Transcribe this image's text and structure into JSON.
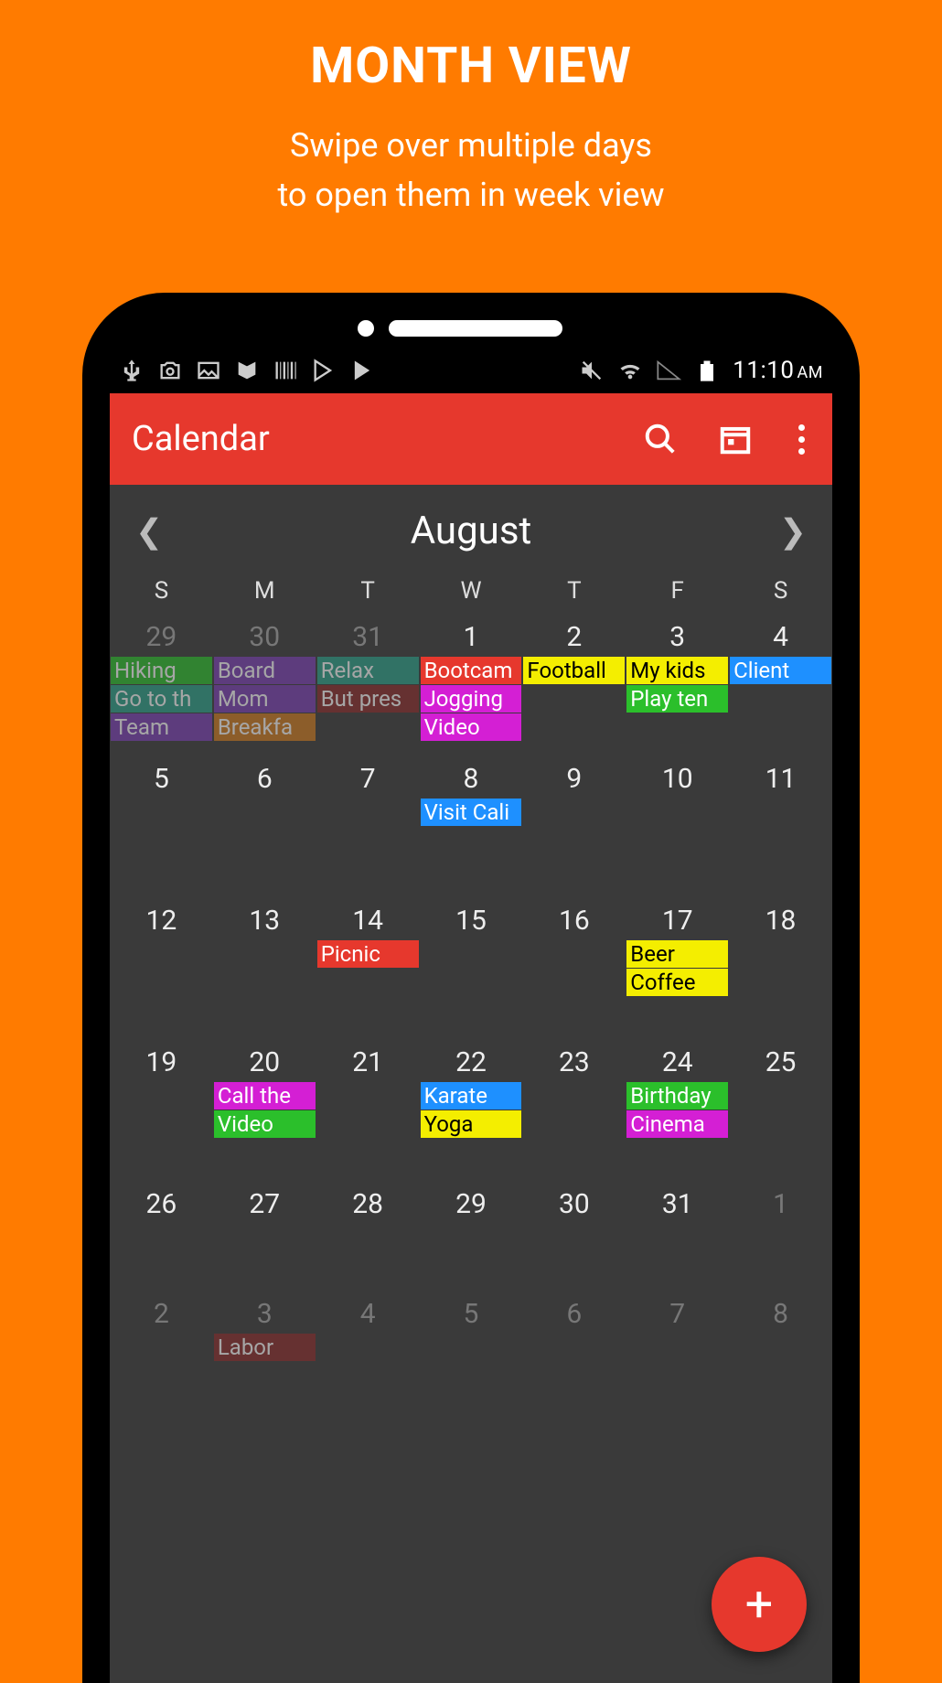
{
  "promo": {
    "title": "MONTH VIEW",
    "subtitle1": "Swipe over multiple days",
    "subtitle2": "to open them in week view"
  },
  "statusbar": {
    "time": "11:10",
    "ampm": "AM"
  },
  "appbar": {
    "title": "Calendar"
  },
  "month": "August",
  "dow": [
    "S",
    "M",
    "T",
    "W",
    "T",
    "F",
    "S"
  ],
  "colors": {
    "green": "#2bbf2b",
    "purple": "#7a3fb5",
    "blue": "#1e90ff",
    "yellow": "#f4ee00",
    "magenta": "#d41fd4",
    "red": "#e6382d",
    "teal": "#2aa089",
    "orange": "#d07a1e",
    "darkred": "#8a2a2a"
  },
  "weeks": [
    [
      {
        "n": "29",
        "dim": true,
        "ev": [
          {
            "t": "Hiking",
            "c": "green",
            "dark": false
          },
          {
            "t": "Go to th",
            "c": "teal",
            "dark": false
          },
          {
            "t": "Team",
            "c": "purple",
            "dark": false
          }
        ]
      },
      {
        "n": "30",
        "dim": true,
        "ev": [
          {
            "t": "Board",
            "c": "purple",
            "dark": false
          },
          {
            "t": "Mom",
            "c": "purple",
            "dark": false
          },
          {
            "t": "Breakfa",
            "c": "orange",
            "dark": false
          }
        ]
      },
      {
        "n": "31",
        "dim": true,
        "ev": [
          {
            "t": "Relax",
            "c": "teal",
            "dark": false
          },
          {
            "t": "But pres",
            "c": "darkred",
            "dark": false
          }
        ]
      },
      {
        "n": "1",
        "dim": false,
        "ev": [
          {
            "t": "Bootcam",
            "c": "red",
            "dark": false
          },
          {
            "t": "Jogging",
            "c": "magenta",
            "dark": false
          },
          {
            "t": "Video",
            "c": "magenta",
            "dark": false
          }
        ]
      },
      {
        "n": "2",
        "dim": false,
        "ev": [
          {
            "t": "Football",
            "c": "yellow",
            "dark": true
          }
        ]
      },
      {
        "n": "3",
        "dim": false,
        "ev": [
          {
            "t": "My kids",
            "c": "yellow",
            "dark": true
          },
          {
            "t": "Play ten",
            "c": "green",
            "dark": false
          }
        ]
      },
      {
        "n": "4",
        "dim": false,
        "ev": [
          {
            "t": "Client",
            "c": "blue",
            "dark": false
          }
        ]
      }
    ],
    [
      {
        "n": "5",
        "dim": false,
        "ev": []
      },
      {
        "n": "6",
        "dim": false,
        "ev": []
      },
      {
        "n": "7",
        "dim": false,
        "ev": []
      },
      {
        "n": "8",
        "dim": false,
        "ev": [
          {
            "t": "Visit Cali",
            "c": "blue",
            "dark": false
          }
        ]
      },
      {
        "n": "9",
        "dim": false,
        "ev": []
      },
      {
        "n": "10",
        "dim": false,
        "ev": []
      },
      {
        "n": "11",
        "dim": false,
        "ev": []
      }
    ],
    [
      {
        "n": "12",
        "dim": false,
        "ev": []
      },
      {
        "n": "13",
        "dim": false,
        "ev": []
      },
      {
        "n": "14",
        "dim": false,
        "ev": [
          {
            "t": "Picnic",
            "c": "red",
            "dark": false
          }
        ]
      },
      {
        "n": "15",
        "dim": false,
        "ev": []
      },
      {
        "n": "16",
        "dim": false,
        "ev": []
      },
      {
        "n": "17",
        "dim": false,
        "ev": [
          {
            "t": "Beer",
            "c": "yellow",
            "dark": true
          },
          {
            "t": "Coffee",
            "c": "yellow",
            "dark": true
          }
        ]
      },
      {
        "n": "18",
        "dim": false,
        "ev": []
      }
    ],
    [
      {
        "n": "19",
        "dim": false,
        "ev": []
      },
      {
        "n": "20",
        "dim": false,
        "ev": [
          {
            "t": "Call the",
            "c": "magenta",
            "dark": false
          },
          {
            "t": "Video",
            "c": "green",
            "dark": false
          }
        ]
      },
      {
        "n": "21",
        "dim": false,
        "ev": []
      },
      {
        "n": "22",
        "dim": false,
        "ev": [
          {
            "t": "Karate",
            "c": "blue",
            "dark": false
          },
          {
            "t": "Yoga",
            "c": "yellow",
            "dark": true
          }
        ]
      },
      {
        "n": "23",
        "dim": false,
        "ev": []
      },
      {
        "n": "24",
        "dim": false,
        "ev": [
          {
            "t": "Birthday",
            "c": "green",
            "dark": false
          },
          {
            "t": "Cinema",
            "c": "magenta",
            "dark": false
          }
        ]
      },
      {
        "n": "25",
        "dim": false,
        "ev": []
      }
    ],
    [
      {
        "n": "26",
        "dim": false,
        "ev": []
      },
      {
        "n": "27",
        "dim": false,
        "ev": []
      },
      {
        "n": "28",
        "dim": false,
        "ev": []
      },
      {
        "n": "29",
        "dim": false,
        "ev": []
      },
      {
        "n": "30",
        "dim": false,
        "ev": []
      },
      {
        "n": "31",
        "dim": false,
        "ev": []
      },
      {
        "n": "1",
        "dim": true,
        "ev": []
      }
    ],
    [
      {
        "n": "2",
        "dim": true,
        "ev": []
      },
      {
        "n": "3",
        "dim": true,
        "ev": [
          {
            "t": "Labor",
            "c": "darkred",
            "dark": false
          }
        ]
      },
      {
        "n": "4",
        "dim": true,
        "ev": []
      },
      {
        "n": "5",
        "dim": true,
        "ev": []
      },
      {
        "n": "6",
        "dim": true,
        "ev": []
      },
      {
        "n": "7",
        "dim": true,
        "ev": []
      },
      {
        "n": "8",
        "dim": true,
        "ev": []
      }
    ]
  ],
  "fab": "+"
}
